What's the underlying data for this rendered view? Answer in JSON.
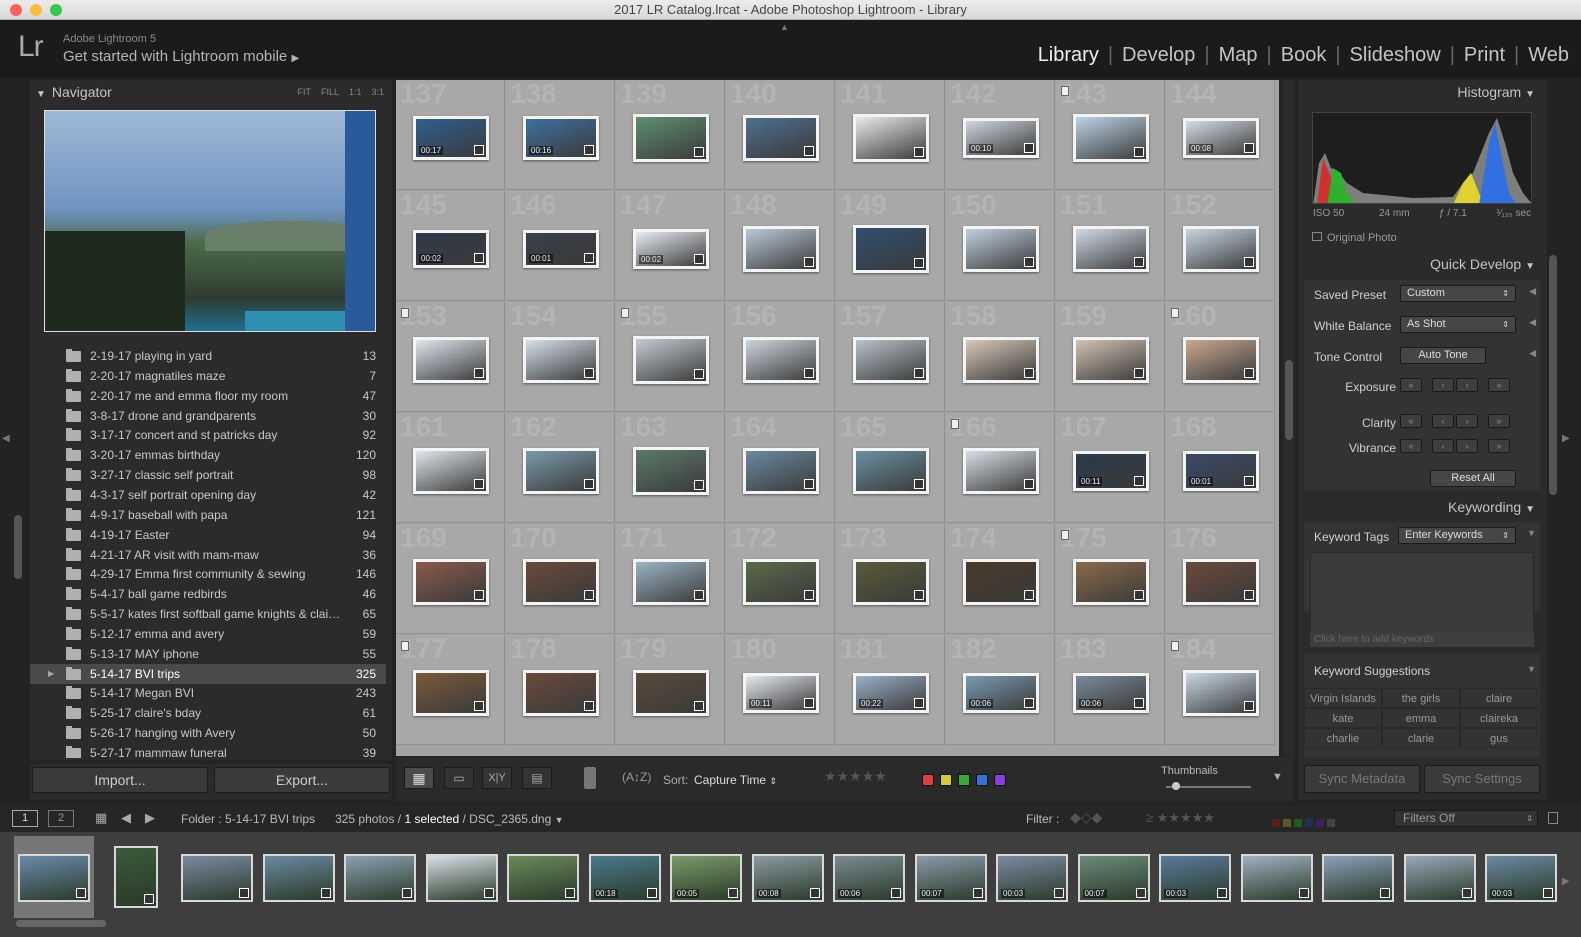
{
  "window": {
    "title": "2017 LR Catalog.lrcat - Adobe Photoshop Lightroom - Library"
  },
  "identity": {
    "logo": "Lr",
    "version": "Adobe Lightroom 5",
    "mobile": "Get started with Lightroom mobile"
  },
  "modules": [
    "Library",
    "Develop",
    "Map",
    "Book",
    "Slideshow",
    "Print",
    "Web"
  ],
  "navigator": {
    "title": "Navigator",
    "zoom": [
      "FIT",
      "FILL",
      "1:1",
      "3:1"
    ]
  },
  "folders": [
    {
      "name": "2-19-17 playing in yard",
      "count": "13"
    },
    {
      "name": "2-20-17 magnatiles maze",
      "count": "7"
    },
    {
      "name": "2-20-17 me and emma floor my room",
      "count": "47"
    },
    {
      "name": "3-8-17 drone and grandparents",
      "count": "30"
    },
    {
      "name": "3-17-17 concert and st patricks day",
      "count": "92"
    },
    {
      "name": "3-20-17 emmas birthday",
      "count": "120"
    },
    {
      "name": "3-27-17 classic self portrait",
      "count": "98"
    },
    {
      "name": "4-3-17 self portrait opening day",
      "count": "42"
    },
    {
      "name": "4-9-17 baseball with papa",
      "count": "121"
    },
    {
      "name": "4-19-17 Easter",
      "count": "94"
    },
    {
      "name": "4-21-17 AR visit with mam-maw",
      "count": "36"
    },
    {
      "name": "4-29-17 Emma first community & sewing",
      "count": "146"
    },
    {
      "name": "5-4-17 ball game redbirds",
      "count": "46"
    },
    {
      "name": "5-5-17 kates first softball game knights & clai…",
      "count": "65"
    },
    {
      "name": "5-12-17 emma and avery",
      "count": "59"
    },
    {
      "name": "5-13-17  MAY iphone",
      "count": "55"
    },
    {
      "name": "5-14-17  BVI trips",
      "count": "325",
      "selected": true
    },
    {
      "name": "5-14-17 Megan BVI",
      "count": "243"
    },
    {
      "name": "5-25-17 claire's bday",
      "count": "61"
    },
    {
      "name": "5-26-17 hanging with Avery",
      "count": "50"
    },
    {
      "name": "5-27-17 mammaw funeral",
      "count": "39"
    }
  ],
  "leftbuttons": {
    "import": "Import...",
    "export": "Export..."
  },
  "grid": {
    "numbers": [
      "137",
      "138",
      "139",
      "140",
      "141",
      "142",
      "143",
      "144",
      "145",
      "146",
      "147",
      "148",
      "149",
      "150",
      "151",
      "152",
      "153",
      "154",
      "155",
      "156",
      "157",
      "158",
      "159",
      "160",
      "161",
      "162",
      "163",
      "164",
      "165",
      "166",
      "167",
      "168",
      "169",
      "170",
      "171",
      "172",
      "173",
      "174",
      "175",
      "176",
      "177",
      "178",
      "179",
      "180",
      "181",
      "182",
      "183",
      "184"
    ],
    "durations": {
      "0": "00:17",
      "1": "00:16",
      "5": "00:10",
      "7": "00:08",
      "8": "00:02",
      "9": "00:01",
      "10": "00:02",
      "30": "00:11",
      "31": "00:01",
      "43": "00:11",
      "44": "00:22",
      "45": "00:06",
      "46": "00:06"
    },
    "flags": [
      6,
      16,
      18,
      23,
      29,
      38,
      40,
      47
    ],
    "colors": [
      "#2f5f8f",
      "#3f6f9f",
      "#5f8f6f",
      "#4f6f8f",
      "#eaeaea",
      "#cfd6de",
      "#bcd3e6",
      "#d6dde6",
      "#2f3a4a",
      "#3a3f48",
      "#e8edf2",
      "#b9c9d8",
      "#2f4f6f",
      "#c0d0e0",
      "#d0dae6",
      "#c8d6e4",
      "#dfe6ee",
      "#d6e0ea",
      "#c4ccd2",
      "#cdd5dc",
      "#b8c2c9",
      "#d8c8b8",
      "#d2c2b2",
      "#c8a890",
      "#e0e6ec",
      "#7a9aaa",
      "#5a7a6a",
      "#6a8aa0",
      "#6a90a0",
      "#d8dfe6",
      "#2a3a4a",
      "#3a4a6a",
      "#8a5a4a",
      "#6a4a3a",
      "#9ab4c4",
      "#5a6a4a",
      "#5a5a3a",
      "#4a3a2a",
      "#8a6a4a",
      "#6a4a3a",
      "#7a5a3a",
      "#6a4a3a",
      "#5a4a3a",
      "#e6eaf0",
      "#9ab0c8",
      "#7a9ab0",
      "#7a8a9a",
      "#c8d8e6"
    ]
  },
  "toolbar": {
    "sort_label": "Sort:",
    "sort_value": "Capture Time",
    "thumbnails": "Thumbnails"
  },
  "histogram": {
    "title": "Histogram",
    "iso": "ISO 50",
    "focal": "24 mm",
    "aperture": "ƒ / 7.1",
    "shutter": "¹⁄₁₂₅ sec",
    "original": "Original Photo"
  },
  "quickdevelop": {
    "title": "Quick Develop",
    "saved_preset": "Saved Preset",
    "preset_value": "Custom",
    "white_balance": "White Balance",
    "wb_value": "As Shot",
    "tone_control": "Tone Control",
    "auto_tone": "Auto Tone",
    "exposure": "Exposure",
    "clarity": "Clarity",
    "vibrance": "Vibrance",
    "reset": "Reset All"
  },
  "keywording": {
    "title": "Keywording",
    "tags_label": "Keyword Tags",
    "tags_value": "Enter Keywords",
    "placeholder": "Click here to add keywords",
    "suggestions_title": "Keyword Suggestions",
    "suggestions": [
      "Virgin Islands",
      "the girls",
      "claire",
      "kate",
      "emma",
      "claireka",
      "charlie",
      "clarie",
      "gus"
    ]
  },
  "sync": {
    "metadata": "Sync Metadata",
    "settings": "Sync Settings"
  },
  "filmbar": {
    "page1": "1",
    "page2": "2",
    "folder": "Folder : 5-14-17  BVI trips",
    "count": "325 photos /",
    "selected": "1 selected",
    "file": "/ DSC_2365.dng",
    "filter": "Filter :",
    "filters_off": "Filters Off"
  },
  "filmstrip": {
    "durations": {
      "7": "00:18",
      "8": "00:05",
      "9": "00:08",
      "10": "00:06",
      "11": "00:07",
      "12": "00:03",
      "13": "00:07",
      "14": "00:03",
      "18": "00:03"
    },
    "colors": [
      "#6a8aaa",
      "#3a5a3a",
      "#7a8aa0",
      "#6a8aa0",
      "#8aa0b0",
      "#d8e0e6",
      "#6a8a5a",
      "#4a7a8a",
      "#7a9a6a",
      "#8a9aa0",
      "#7a8a90",
      "#8a9aa8",
      "#7a8aa0",
      "#6a8a7a",
      "#5a7a9a",
      "#a0b0c0",
      "#8aa0b8",
      "#98a8b8",
      "#6a8aa0"
    ]
  }
}
